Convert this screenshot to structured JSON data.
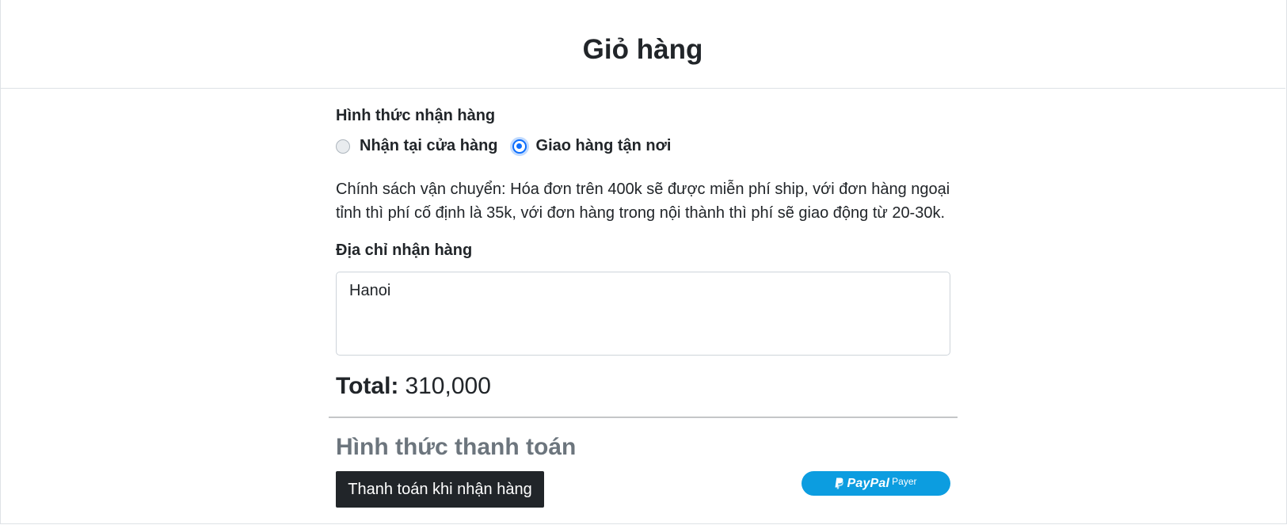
{
  "header": {
    "title": "Giỏ hàng"
  },
  "delivery": {
    "label": "Hình thức nhận hàng",
    "options": [
      {
        "label": "Nhận tại cửa hàng",
        "selected": false
      },
      {
        "label": "Giao hàng tận nơi",
        "selected": true
      }
    ],
    "policy": "Chính sách vận chuyển: Hóa đơn trên 400k sẽ được miễn phí ship, với đơn hàng ngoại tỉnh thì phí cố định là 35k, với đơn hàng trong nội thành thì phí sẽ giao động từ 20-30k."
  },
  "address": {
    "label": "Địa chỉ nhận hàng",
    "value": "Hanoi"
  },
  "total": {
    "label": "Total:",
    "value": "310,000"
  },
  "payment": {
    "title": "Hình thức thanh toán",
    "cod_label": "Thanh toán khi nhận hàng",
    "paypal": {
      "brand": "PayPal",
      "suffix": "Payer",
      "icon": "paypal-icon"
    }
  },
  "colors": {
    "accent": "#0d6efd",
    "paypal": "#0c9de0",
    "dark_button": "#212529",
    "muted": "#6c757d"
  }
}
